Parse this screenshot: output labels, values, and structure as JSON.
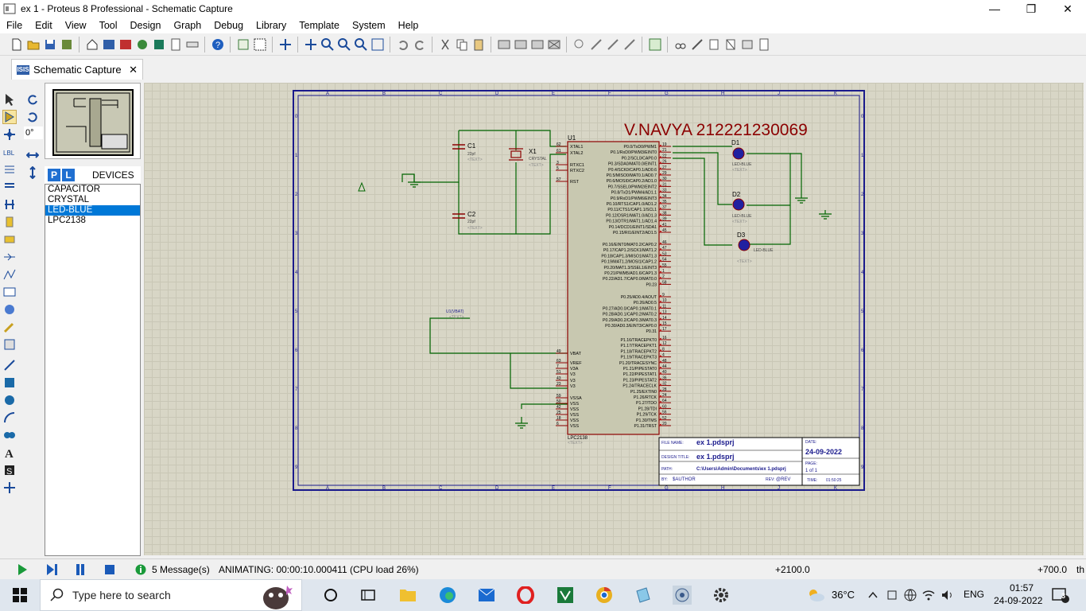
{
  "window": {
    "title": "ex 1 - Proteus 8 Professional - Schematic Capture",
    "controls": [
      "minimize",
      "restore",
      "close"
    ]
  },
  "menu": [
    "File",
    "Edit",
    "View",
    "Tool",
    "Design",
    "Graph",
    "Debug",
    "Library",
    "Template",
    "System",
    "Help"
  ],
  "tab": {
    "label": "Schematic Capture",
    "close": "✕"
  },
  "left_panel": {
    "rotation": "0°",
    "devices_title": "DEVICES",
    "p_button": "P",
    "l_button": "L",
    "devices": [
      "CAPACITOR",
      "CRYSTAL",
      "LED-BLUE",
      "LPC2138"
    ],
    "selected_device": "LED-BLUE"
  },
  "schematic": {
    "author_text": "V.NAVYA 212221230069",
    "u1": "U1",
    "u1_part": "LPC2138",
    "u1_text": "<TEXT>",
    "c1": "C1",
    "c1_val": "22pf",
    "c2": "C2",
    "c2_val": "22pf",
    "x1": "X1",
    "x1_val": "CRYSTAL",
    "text_tag": "<TEXT>",
    "d1": "D1",
    "d2": "D2",
    "d3": "D3",
    "led": "LED-BLUE",
    "vbat_label": "U1(VBAT)",
    "col_labels": [
      "A",
      "B",
      "C",
      "D",
      "E",
      "F",
      "G",
      "H",
      "J",
      "K"
    ],
    "row_labels": [
      "0",
      "1",
      "2",
      "3",
      "4",
      "5",
      "6",
      "7",
      "8",
      "9"
    ],
    "left_pins": [
      {
        "num": "62",
        "name": "XTAL1"
      },
      {
        "num": "61",
        "name": "XTAL2"
      },
      {
        "num": "3",
        "name": "RTXC1"
      },
      {
        "num": "5",
        "name": "RTXC2"
      },
      {
        "num": "57",
        "name": "RST"
      }
    ],
    "left_pins_lower": [
      {
        "num": "49",
        "name": "VBAT"
      },
      {
        "num": "63",
        "name": "VREF"
      },
      {
        "num": "7",
        "name": "V3A"
      },
      {
        "num": "51",
        "name": "V3"
      },
      {
        "num": "43",
        "name": "V3"
      },
      {
        "num": "23",
        "name": "V3"
      },
      {
        "num": "59",
        "name": "VSSA"
      },
      {
        "num": "50",
        "name": "VSS"
      },
      {
        "num": "42",
        "name": "VSS"
      },
      {
        "num": "25",
        "name": "VSS"
      },
      {
        "num": "18",
        "name": "VSS"
      },
      {
        "num": "6",
        "name": "VSS"
      }
    ],
    "right_pins": [
      {
        "name": "P0.0/TxD0/PWM1",
        "num": "19"
      },
      {
        "name": "P0.1/RxD0/PWM3/EINT0",
        "num": "21"
      },
      {
        "name": "P0.2/SCL0/CAP0.0",
        "num": "22"
      },
      {
        "name": "P0.3/SDA0/MAT0.0/EINT1",
        "num": "26"
      },
      {
        "name": "P0.4/SCK0/CAP0.1/AD0.6",
        "num": "27"
      },
      {
        "name": "P0.5/MISO0/MAT0.1/AD0.7",
        "num": "29"
      },
      {
        "name": "P0.6/MOSI0/CAP0.2/AD1.0",
        "num": "30"
      },
      {
        "name": "P0.7/SSEL0/PWM2/EINT2",
        "num": "31"
      },
      {
        "name": "P0.8/TxD1/PWM4/AD1.1",
        "num": "33"
      },
      {
        "name": "P0.9/RxD1/PWM6/EINT3",
        "num": "34"
      },
      {
        "name": "P0.10/RTS1/CAP1.0/AD1.2",
        "num": "35"
      },
      {
        "name": "P0.11/CTS1/CAP1.1/SCL1",
        "num": "37"
      },
      {
        "name": "P0.12/DSR1/MAT1.0/AD1.3",
        "num": "38"
      },
      {
        "name": "P0.13/DTR1/MAT1.1/AD1.4",
        "num": "39"
      },
      {
        "name": "P0.14/DCD1/EINT1/SDA1",
        "num": "41"
      },
      {
        "name": "P0.15/RI1/EINT2/AD1.5",
        "num": "45"
      },
      {
        "name": "P0.16/EINT0/MAT0.2/CAP0.2",
        "num": "46"
      },
      {
        "name": "P0.17/CAP1.2/SCK1/MAT1.2",
        "num": "47"
      },
      {
        "name": "P0.18/CAP1.3/MISO1/MAT1.3",
        "num": "53"
      },
      {
        "name": "P0.19/MAT1.2/MOSI1/CAP1.2",
        "num": "54"
      },
      {
        "name": "P0.20/MAT1.3/SSEL1/EINT3",
        "num": "55"
      },
      {
        "name": "P0.21/PWM5/AD1.6/CAP1.3",
        "num": "1"
      },
      {
        "name": "P0.22/AD1.7/CAP0.0/MAT0.0",
        "num": "2"
      },
      {
        "name": "P0.23",
        "num": "58"
      },
      {
        "name": "P0.25/AD0.4/AOUT",
        "num": "9"
      },
      {
        "name": "P0.26/AD0.5",
        "num": "10"
      },
      {
        "name": "P0.27/AD0.0/CAP0.1/MAT0.1",
        "num": "11"
      },
      {
        "name": "P0.28/AD0.1/CAP0.2/MAT0.2",
        "num": "13"
      },
      {
        "name": "P0.29/AD0.2/CAP0.3/MAT0.3",
        "num": "14"
      },
      {
        "name": "P0.30/AD0.3/EINT3/CAP0.0",
        "num": "15"
      },
      {
        "name": "P0.31",
        "num": "17"
      },
      {
        "name": "P1.16/TRACEPKT0",
        "num": "16"
      },
      {
        "name": "P1.17/TRACEPKT1",
        "num": "12"
      },
      {
        "name": "P1.18/TRACEPKT2",
        "num": "8"
      },
      {
        "name": "P1.19/TRACEPKT3",
        "num": "4"
      },
      {
        "name": "P1.20/TRACESYNC",
        "num": "48"
      },
      {
        "name": "P1.21/PIPESTAT0",
        "num": "44"
      },
      {
        "name": "P1.22/PIPESTAT1",
        "num": "40"
      },
      {
        "name": "P1.23/PIPESTAT2",
        "num": "36"
      },
      {
        "name": "P1.24/TRACECLK",
        "num": "32"
      },
      {
        "name": "P1.25/EXTIN0",
        "num": "28"
      },
      {
        "name": "P1.26/RTCK",
        "num": "24"
      },
      {
        "name": "P1.27/TDO",
        "num": "64"
      },
      {
        "name": "P1.28/TDI",
        "num": "60"
      },
      {
        "name": "P1.29/TCK",
        "num": "56"
      },
      {
        "name": "P1.30/TMS",
        "num": "52"
      },
      {
        "name": "P1.31/TRST",
        "num": "20"
      }
    ],
    "title_block": {
      "file_name_label": "FILE NAME:",
      "file_name": "ex 1.pdsprj",
      "design_title_label": "DESIGN TITLE:",
      "design_title": "ex 1.pdsprj",
      "path_label": "PATH:",
      "path": "C:\\Users\\Admin\\Documents\\ex 1.pdsprj",
      "by_label": "BY:",
      "by": "$AUTHOR",
      "rev_label": "REV:",
      "rev": "@REV",
      "date_label": "DATE:",
      "date": "24-09-2022",
      "page_label": "PAGE:",
      "page": "1    of    1",
      "time_label": "TIME:",
      "time": "01:50:25"
    }
  },
  "status": {
    "messages": "5 Message(s)",
    "animating": "ANIMATING: 00:00:10.000411 (CPU load 26%)",
    "coord_x": "+2100.0",
    "coord_y": "+700.0",
    "units": "th"
  },
  "taskbar": {
    "search_placeholder": "Type here to search",
    "weather": "36°C",
    "lang": "ENG",
    "time": "01:57",
    "date": "24-09-2022",
    "notifications": "3"
  },
  "colors": {
    "wire": "#006400",
    "border": "#1a1a8c",
    "component": "#8b0000",
    "chip_fill": "#c8c8b0",
    "led": "#2020a0"
  }
}
